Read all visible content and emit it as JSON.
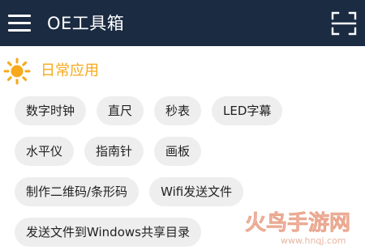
{
  "app_bar": {
    "title": "OE工具箱",
    "menu_icon": "hamburger-menu-icon",
    "scan_icon": "scan-frame-icon",
    "background_color": "#1a2b42"
  },
  "section": {
    "icon": "sun-icon",
    "title": "日常应用",
    "accent_color": "#f7a91b"
  },
  "tools": {
    "row1": [
      "数字时钟",
      "直尺",
      "秒表",
      "LED字幕"
    ],
    "row2": [
      "水平仪",
      "指南针",
      "画板"
    ],
    "row3": [
      "制作二维码/条形码",
      "Wifi发送文件"
    ],
    "row4": [
      "发送文件到Windows共享目录"
    ]
  },
  "watermark": {
    "brand": "火鸟手游网",
    "url": "www.hnqj.com"
  }
}
